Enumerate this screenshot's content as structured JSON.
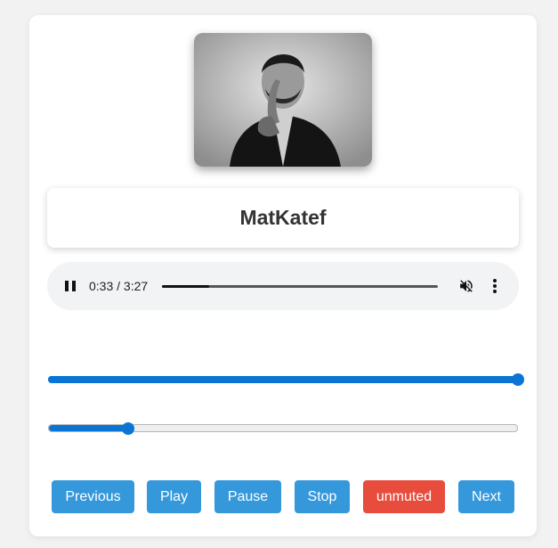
{
  "track": {
    "artist": "MatKatef"
  },
  "cover": {
    "alt": "album-cover"
  },
  "player": {
    "time_display": "0:33 / 3:27",
    "progress_fraction": 0.17,
    "muted": true
  },
  "sliders": {
    "volume_fraction": 1.0,
    "seek_fraction": 0.17
  },
  "buttons": [
    {
      "label": "Previous",
      "color": "#3498db"
    },
    {
      "label": "Play",
      "color": "#3498db"
    },
    {
      "label": "Pause",
      "color": "#3498db"
    },
    {
      "label": "Stop",
      "color": "#3498db"
    },
    {
      "label": "unmuted",
      "color": "#e74c3c"
    },
    {
      "label": "Next",
      "color": "#3498db"
    }
  ],
  "colors": {
    "accent": "#0a75d4",
    "button_blue": "#3498db",
    "button_red": "#e74c3c"
  }
}
